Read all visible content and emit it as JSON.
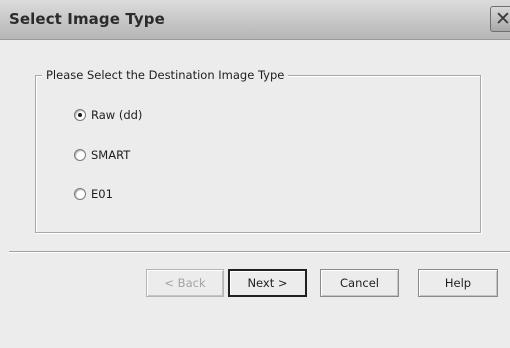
{
  "window": {
    "title": "Select Image Type",
    "close_glyph": "✕"
  },
  "group": {
    "legend": "Please Select the Destination Image Type",
    "options": [
      {
        "label": "Raw (dd)",
        "selected": true
      },
      {
        "label": "SMART",
        "selected": false
      },
      {
        "label": "E01",
        "selected": false
      }
    ]
  },
  "buttons": {
    "back": "< Back",
    "next": "Next >",
    "cancel": "Cancel",
    "help": "Help"
  }
}
